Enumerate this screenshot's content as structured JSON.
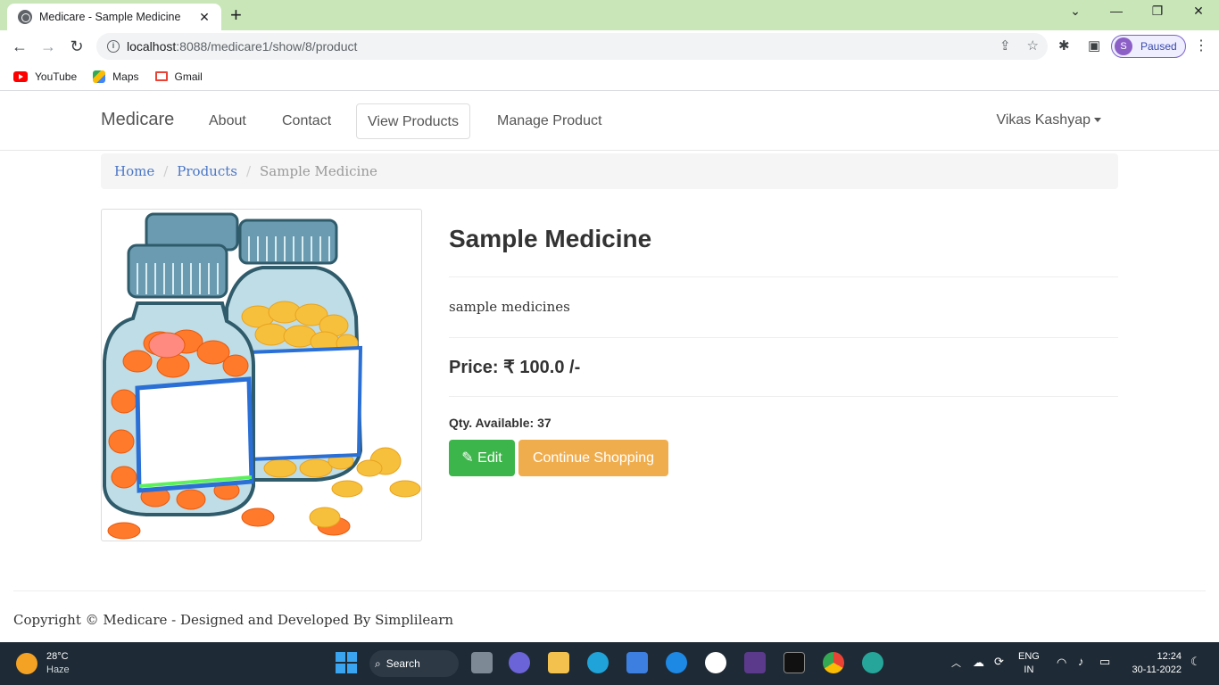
{
  "browser": {
    "tab_title": "Medicare - Sample Medicine",
    "url_host": "localhost",
    "url_path": ":8088/medicare1/show/8/product",
    "profile_initial": "S",
    "profile_status": "Paused",
    "bookmarks": [
      {
        "label": "YouTube",
        "icon": "youtube-icon"
      },
      {
        "label": "Maps",
        "icon": "maps-icon"
      },
      {
        "label": "Gmail",
        "icon": "gmail-icon"
      }
    ]
  },
  "navbar": {
    "brand": "Medicare",
    "links": [
      "About",
      "Contact",
      "View Products",
      "Manage Product"
    ],
    "active_link": "View Products",
    "user": "Vikas Kashyap"
  },
  "breadcrumb": {
    "home": "Home",
    "products": "Products",
    "current": "Sample Medicine"
  },
  "product": {
    "name": "Sample Medicine",
    "description": "sample medicines",
    "price": "Price: ₹ 100.0 /-",
    "qty_label": "Qty. Available:",
    "qty_value": "37",
    "edit_label": "Edit",
    "continue_label": "Continue Shopping"
  },
  "footer": {
    "text": "Copyright © Medicare - Designed and Developed By Simplilearn"
  },
  "taskbar": {
    "temperature": "28°C",
    "condition": "Haze",
    "search_label": "Search",
    "lang_top": "ENG",
    "lang_bottom": "IN",
    "time": "12:24",
    "date": "30-11-2022"
  },
  "colors": {
    "accent_link": "#4a76c6",
    "btn_edit": "#3cb54a",
    "btn_continue": "#f0ad4e",
    "tab_strip": "#c8e6b7"
  }
}
